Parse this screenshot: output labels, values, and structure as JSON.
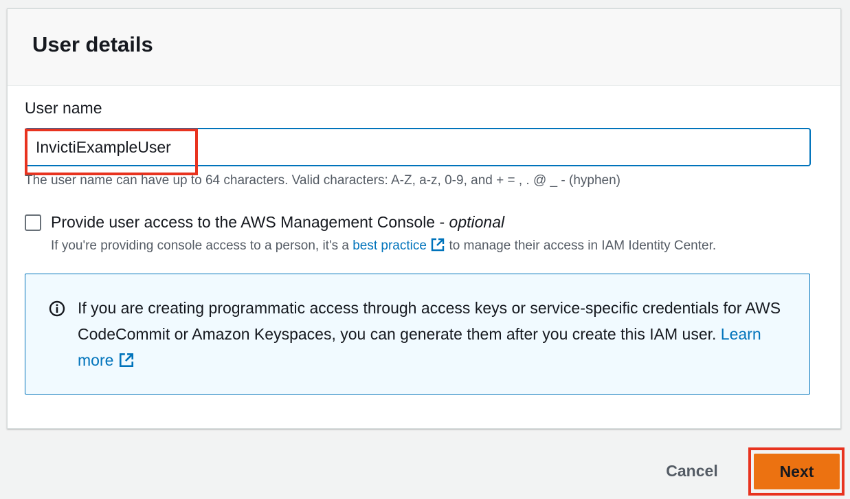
{
  "panel": {
    "title": "User details"
  },
  "user_name": {
    "label": "User name",
    "value": "InvictiExampleUser",
    "hint": "The user name can have up to 64 characters. Valid characters: A-Z, a-z, 0-9, and + = , . @ _ - (hyphen)"
  },
  "console_access": {
    "checked": false,
    "label": "Provide user access to the AWS Management Console - ",
    "label_optional": "optional",
    "desc_before": "If you're providing console access to a person, it's a ",
    "desc_link": "best practice",
    "desc_after": " to manage their access in IAM Identity Center."
  },
  "info": {
    "text": "If you are creating programmatic access through access keys or service-specific credentials for AWS CodeCommit or Amazon Keyspaces, you can generate them after you create this IAM user. ",
    "link": "Learn more"
  },
  "actions": {
    "cancel": "Cancel",
    "next": "Next"
  },
  "colors": {
    "accent_link": "#0073bb",
    "primary_button": "#ec7211",
    "highlight": "#e8331f",
    "info_background": "#f1faff"
  }
}
